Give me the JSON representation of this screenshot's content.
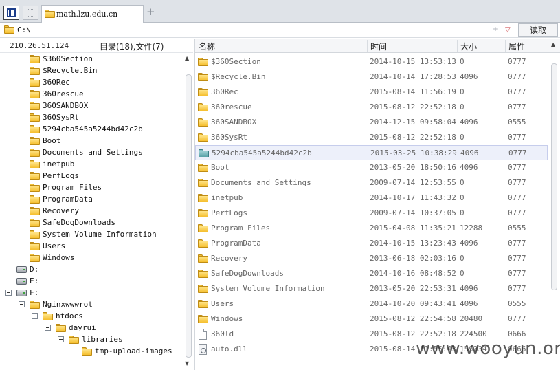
{
  "tabs": [
    {
      "label": "math.lzu.edu.cn",
      "active": true
    }
  ],
  "tab_add_symbol": "+",
  "address": {
    "path": "C:\\",
    "up_symbol": "±",
    "dropdown_symbol": "▽"
  },
  "read_button": "读取",
  "info": {
    "ip": "210.26.51.124",
    "stats": "目录(18),文件(7)"
  },
  "tree": [
    {
      "label": "$360Section",
      "type": "folder",
      "depth": 2
    },
    {
      "label": "$Recycle.Bin",
      "type": "folder",
      "depth": 2
    },
    {
      "label": "360Rec",
      "type": "folder",
      "depth": 2
    },
    {
      "label": "360rescue",
      "type": "folder",
      "depth": 2
    },
    {
      "label": "360SANDBOX",
      "type": "folder",
      "depth": 2
    },
    {
      "label": "360SysRt",
      "type": "folder",
      "depth": 2
    },
    {
      "label": "5294cba545a5244bd42c2b",
      "type": "folder",
      "depth": 2
    },
    {
      "label": "Boot",
      "type": "folder",
      "depth": 2
    },
    {
      "label": "Documents and Settings",
      "type": "folder",
      "depth": 2
    },
    {
      "label": "inetpub",
      "type": "folder",
      "depth": 2
    },
    {
      "label": "PerfLogs",
      "type": "folder",
      "depth": 2
    },
    {
      "label": "Program Files",
      "type": "folder",
      "depth": 2
    },
    {
      "label": "ProgramData",
      "type": "folder",
      "depth": 2
    },
    {
      "label": "Recovery",
      "type": "folder",
      "depth": 2
    },
    {
      "label": "SafeDogDownloads",
      "type": "folder",
      "depth": 2
    },
    {
      "label": "System Volume Information",
      "type": "folder",
      "depth": 2
    },
    {
      "label": "Users",
      "type": "folder",
      "depth": 2
    },
    {
      "label": "Windows",
      "type": "folder",
      "depth": 2
    },
    {
      "label": "D:",
      "type": "drive",
      "depth": 1
    },
    {
      "label": "E:",
      "type": "drive",
      "depth": 1
    },
    {
      "label": "F:",
      "type": "drive",
      "depth": 1,
      "expanded": true
    },
    {
      "label": "Nginxwwwrot",
      "type": "folder",
      "depth": 2,
      "expanded": true
    },
    {
      "label": "htdocs",
      "type": "folder",
      "depth": 3,
      "expanded": true
    },
    {
      "label": "dayrui",
      "type": "folder",
      "depth": 4,
      "expanded": true
    },
    {
      "label": "libraries",
      "type": "folder",
      "depth": 5,
      "expanded": true
    },
    {
      "label": "tmp-upload-images",
      "type": "folder",
      "depth": 6
    }
  ],
  "columns": [
    "名称",
    "时间",
    "大小",
    "属性"
  ],
  "files": [
    {
      "name": "$360Section",
      "time": "2014-10-15 13:53:13",
      "size": "0",
      "attr": "0777",
      "type": "folder"
    },
    {
      "name": "$Recycle.Bin",
      "time": "2014-10-14 17:28:53",
      "size": "4096",
      "attr": "0777",
      "type": "folder"
    },
    {
      "name": "360Rec",
      "time": "2015-08-14 11:56:19",
      "size": "0",
      "attr": "0777",
      "type": "folder"
    },
    {
      "name": "360rescue",
      "time": "2015-08-12 22:52:18",
      "size": "0",
      "attr": "0777",
      "type": "folder"
    },
    {
      "name": "360SANDBOX",
      "time": "2014-12-15 09:58:04",
      "size": "4096",
      "attr": "0555",
      "type": "folder"
    },
    {
      "name": "360SysRt",
      "time": "2015-08-12 22:52:18",
      "size": "0",
      "attr": "0777",
      "type": "folder"
    },
    {
      "name": "5294cba545a5244bd42c2b",
      "time": "2015-03-25 10:38:29",
      "size": "4096",
      "attr": "0777",
      "type": "folder",
      "selected": true
    },
    {
      "name": "Boot",
      "time": "2013-05-20 18:50:16",
      "size": "4096",
      "attr": "0777",
      "type": "folder"
    },
    {
      "name": "Documents and Settings",
      "time": "2009-07-14 12:53:55",
      "size": "0",
      "attr": "0777",
      "type": "folder"
    },
    {
      "name": "inetpub",
      "time": "2014-10-17 11:43:32",
      "size": "0",
      "attr": "0777",
      "type": "folder"
    },
    {
      "name": "PerfLogs",
      "time": "2009-07-14 10:37:05",
      "size": "0",
      "attr": "0777",
      "type": "folder"
    },
    {
      "name": "Program Files",
      "time": "2015-04-08 11:35:21",
      "size": "12288",
      "attr": "0555",
      "type": "folder"
    },
    {
      "name": "ProgramData",
      "time": "2014-10-15 13:23:43",
      "size": "4096",
      "attr": "0777",
      "type": "folder"
    },
    {
      "name": "Recovery",
      "time": "2013-06-18 02:03:16",
      "size": "0",
      "attr": "0777",
      "type": "folder"
    },
    {
      "name": "SafeDogDownloads",
      "time": "2014-10-16 08:48:52",
      "size": "0",
      "attr": "0777",
      "type": "folder"
    },
    {
      "name": "System Volume Information",
      "time": "2013-05-20 22:53:31",
      "size": "4096",
      "attr": "0777",
      "type": "folder"
    },
    {
      "name": "Users",
      "time": "2014-10-20 09:43:41",
      "size": "4096",
      "attr": "0555",
      "type": "folder"
    },
    {
      "name": "Windows",
      "time": "2015-08-12 22:54:58",
      "size": "20480",
      "attr": "0777",
      "type": "folder"
    },
    {
      "name": "360ld",
      "time": "2015-08-12 22:52:18",
      "size": "224500",
      "attr": "0666",
      "type": "file"
    },
    {
      "name": "auto.dll",
      "time": "2015-08-14 11:55:43",
      "size": "159334",
      "attr": "0666",
      "type": "dll"
    }
  ],
  "scroll_arrows": {
    "up": "▲",
    "down": "▼"
  },
  "watermark": "www.wooyun.org"
}
